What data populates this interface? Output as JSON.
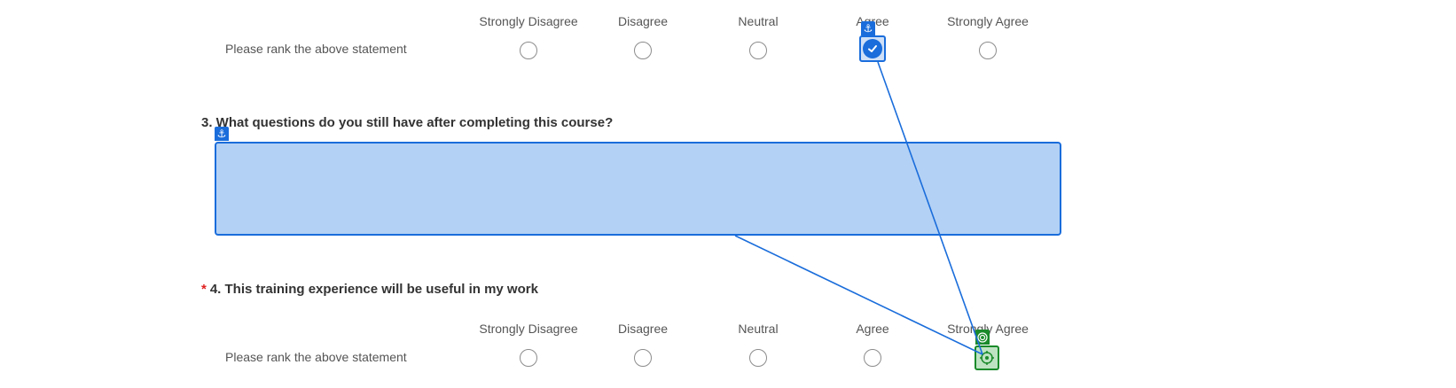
{
  "scale_labels": [
    "Strongly Disagree",
    "Disagree",
    "Neutral",
    "Agree",
    "Strongly Agree"
  ],
  "q2": {
    "row_label": "Please rank the above statement",
    "selected": "Agree"
  },
  "q3": {
    "title": "3. What questions do you still have after completing this course?",
    "answer": ""
  },
  "q4": {
    "required_marker": "*",
    "title": "4. This training experience will be useful in my work",
    "row_label": "Please rank the above statement",
    "selected": ""
  },
  "overlay": {
    "anchor_icon": "anchor-icon",
    "target_icon": "crosshair-icon",
    "anchor_color": "#1a6ddb",
    "target_color": "#1a8a2a"
  }
}
